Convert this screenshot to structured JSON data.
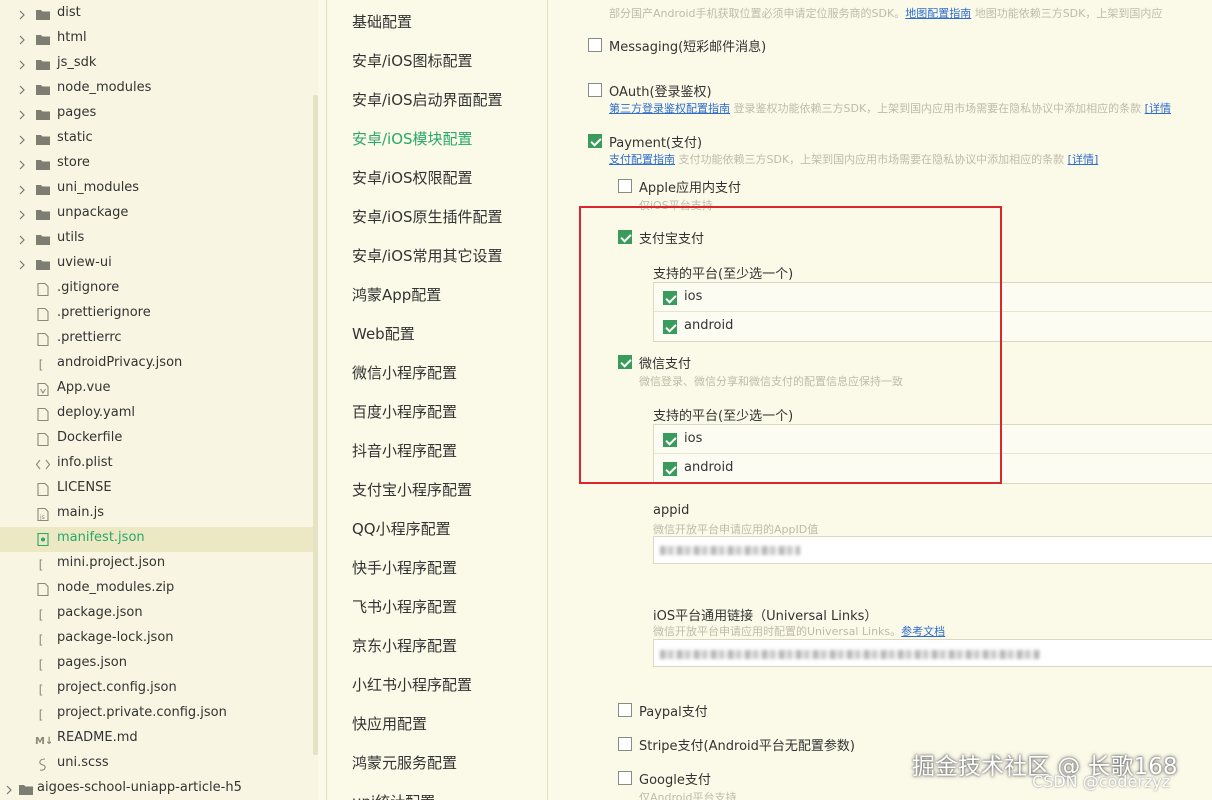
{
  "file_tree": {
    "items": [
      {
        "name": "dist",
        "type": "folder"
      },
      {
        "name": "html",
        "type": "folder"
      },
      {
        "name": "js_sdk",
        "type": "folder"
      },
      {
        "name": "node_modules",
        "type": "folder"
      },
      {
        "name": "pages",
        "type": "folder"
      },
      {
        "name": "static",
        "type": "folder"
      },
      {
        "name": "store",
        "type": "folder"
      },
      {
        "name": "uni_modules",
        "type": "folder"
      },
      {
        "name": "unpackage",
        "type": "folder"
      },
      {
        "name": "utils",
        "type": "folder"
      },
      {
        "name": "uview-ui",
        "type": "folder"
      },
      {
        "name": ".gitignore",
        "type": "file"
      },
      {
        "name": ".prettierignore",
        "type": "file"
      },
      {
        "name": ".prettierrc",
        "type": "file"
      },
      {
        "name": "androidPrivacy.json",
        "type": "json"
      },
      {
        "name": "App.vue",
        "type": "vue"
      },
      {
        "name": "deploy.yaml",
        "type": "file"
      },
      {
        "name": "Dockerfile",
        "type": "file"
      },
      {
        "name": "info.plist",
        "type": "code"
      },
      {
        "name": "LICENSE",
        "type": "file"
      },
      {
        "name": "main.js",
        "type": "js"
      },
      {
        "name": "manifest.json",
        "type": "manifest",
        "selected": true
      },
      {
        "name": "mini.project.json",
        "type": "json"
      },
      {
        "name": "node_modules.zip",
        "type": "file"
      },
      {
        "name": "package.json",
        "type": "json"
      },
      {
        "name": "package-lock.json",
        "type": "json"
      },
      {
        "name": "pages.json",
        "type": "json"
      },
      {
        "name": "project.config.json",
        "type": "json"
      },
      {
        "name": "project.private.config.json",
        "type": "json"
      },
      {
        "name": "README.md",
        "type": "md"
      },
      {
        "name": "uni.scss",
        "type": "scss"
      },
      {
        "name": "aigoes-school-uniapp-article-h5",
        "type": "project"
      }
    ]
  },
  "nav": {
    "items": [
      "基础配置",
      "安卓/iOS图标配置",
      "安卓/iOS启动界面配置",
      "安卓/iOS模块配置",
      "安卓/iOS权限配置",
      "安卓/iOS原生插件配置",
      "安卓/iOS常用其它设置",
      "鸿蒙App配置",
      "Web配置",
      "微信小程序配置",
      "百度小程序配置",
      "抖音小程序配置",
      "支付宝小程序配置",
      "QQ小程序配置",
      "快手小程序配置",
      "飞书小程序配置",
      "京东小程序配置",
      "小红书小程序配置",
      "快应用配置",
      "鸿蒙元服务配置",
      "uni统计配置"
    ],
    "active_index": 3
  },
  "content": {
    "top_hint": "部分国产Android手机获取位置必须申请定位服务商的SDK。",
    "top_hint_link": "地图配置指南",
    "top_hint_tail": "地图功能依赖三方SDK，上架到国内应",
    "messaging": {
      "label": "Messaging(短彩邮件消息)",
      "checked": false
    },
    "oauth": {
      "label": "OAuth(登录鉴权)",
      "checked": false,
      "link": "第三方登录鉴权配置指南",
      "hint": "登录鉴权功能依赖三方SDK，上架到国内应用市场需要在隐私协议中添加相应的条款",
      "detail": "[详情"
    },
    "payment": {
      "label": "Payment(支付)",
      "checked": true,
      "link": "支付配置指南",
      "hint": "支付功能依赖三方SDK，上架到国内应用市场需要在隐私协议中添加相应的条款",
      "detail": "[详情]"
    },
    "apple_pay": {
      "label": "Apple应用内支付",
      "checked": false,
      "hint": "仅iOS平台支持"
    },
    "alipay": {
      "label": "支付宝支付",
      "checked": true,
      "platforms_label": "支持的平台(至少选一个)",
      "platforms": [
        {
          "name": "ios",
          "checked": true
        },
        {
          "name": "android",
          "checked": true
        }
      ]
    },
    "wechat_pay": {
      "label": "微信支付",
      "checked": true,
      "hint": "微信登录、微信分享和微信支付的配置信息应保持一致",
      "platforms_label": "支持的平台(至少选一个)",
      "platforms": [
        {
          "name": "ios",
          "checked": true
        },
        {
          "name": "android",
          "checked": true
        }
      ]
    },
    "appid": {
      "label": "appid",
      "hint": "微信开放平台申请应用的AppID值"
    },
    "universal_links": {
      "label": "iOS平台通用链接（Universal Links）",
      "hint": "微信开放平台申请应用时配置的Universal Links。",
      "link": "参考文档"
    },
    "paypal": {
      "label": "Paypal支付",
      "checked": false
    },
    "stripe": {
      "label": "Stripe支付(Android平台无配置参数)",
      "checked": false
    },
    "google_pay": {
      "label": "Google支付",
      "checked": false,
      "hint": "仅Android平台支持"
    }
  },
  "watermark": {
    "text": "掘金技术社区 @ 长歌168",
    "csdn": "CSDN @coderzyz"
  },
  "colors": {
    "accent": "#29a868",
    "checkbox": "#3a9b5c",
    "highlight": "#d9272d",
    "link": "#2d6dcf"
  }
}
